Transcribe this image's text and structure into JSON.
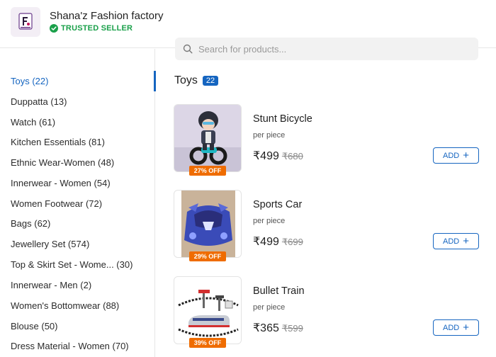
{
  "store": {
    "name": "Shana'z Fashion factory",
    "badge": "TRUSTED SELLER",
    "badge_color": "#1aa04a"
  },
  "search": {
    "placeholder": "Search for products..."
  },
  "categories": [
    {
      "label": "Toys (22)",
      "active": true
    },
    {
      "label": "Duppatta (13)"
    },
    {
      "label": "Watch (61)"
    },
    {
      "label": "Kitchen Essentials (81)"
    },
    {
      "label": "Ethnic Wear-Women (48)"
    },
    {
      "label": "Innerwear - Women (54)"
    },
    {
      "label": "Women Footwear (72)"
    },
    {
      "label": "Bags (62)"
    },
    {
      "label": "Jewellery Set (574)"
    },
    {
      "label": "Top & Skirt Set - Wome... (30)"
    },
    {
      "label": "Innerwear - Men (2)"
    },
    {
      "label": "Women's Bottomwear (88)"
    },
    {
      "label": "Blouse (50)"
    },
    {
      "label": "Dress Material - Women (70)"
    }
  ],
  "section": {
    "title": "Toys",
    "count": "22"
  },
  "products": [
    {
      "name": "Stunt Bicycle",
      "unit": "per piece",
      "price": "₹499",
      "mrp": "₹680",
      "discount": "27% OFF",
      "add_label": "ADD"
    },
    {
      "name": "Sports Car",
      "unit": "per piece",
      "price": "₹499",
      "mrp": "₹699",
      "discount": "29% OFF",
      "add_label": "ADD"
    },
    {
      "name": "Bullet Train",
      "unit": "per piece",
      "price": "₹365",
      "mrp": "₹599",
      "discount": "39% OFF",
      "add_label": "ADD"
    }
  ],
  "colors": {
    "accent": "#1565c0",
    "discount": "#ef6c00"
  }
}
